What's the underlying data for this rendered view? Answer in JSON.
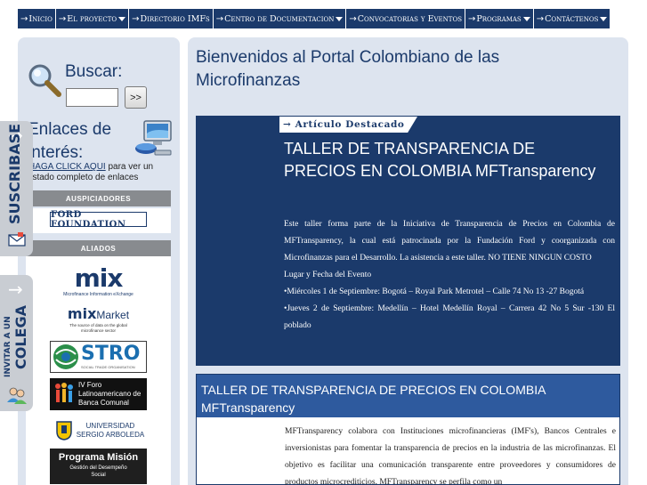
{
  "nav": {
    "items": [
      {
        "label": "Inicio",
        "dropdown": false
      },
      {
        "label": "El proyecto",
        "dropdown": true
      },
      {
        "label": "Directorio IMFs",
        "dropdown": false
      },
      {
        "label": "Centro de Documentacion",
        "dropdown": true
      },
      {
        "label": "Convocatorias y Eventos",
        "dropdown": false
      },
      {
        "label": "Programas",
        "dropdown": true
      },
      {
        "label": "Contáctenos",
        "dropdown": true
      }
    ],
    "arrow": "→"
  },
  "sidebar": {
    "search_title": "Buscar:",
    "search_value": "",
    "search_button": ">>",
    "links_title": "Enlaces de interés:",
    "links_link": "HAGA CLICK AQUI",
    "links_rest": " para ver un listado completo de enlaces",
    "sponsors_header": "AUSPICIADORES",
    "ford_logo": "FORD FOUNDATION",
    "allies_header": "ALIADOS",
    "mix_logo": "mix",
    "mix_tagline": "Microfinance Information eXchange",
    "mixmarket_logo": "mix",
    "mixmarket_word": "Market",
    "mixmarket_tagline": "The source of data on the global microfinance sector",
    "stro_logo": "STRO",
    "stro_tagline": "SOCIAL TRADE ORGANISATION",
    "foro_logo_line1": "IV Foro",
    "foro_logo_line2": "Latinoamericano de",
    "foro_logo_line3": "Banca Comunal",
    "usa_line1": "UNIVERSIDAD",
    "usa_line2": "SERGIO ARBOLEDA",
    "programa_line1": "Programa Misión",
    "programa_line2": "Gestión del Desempeño",
    "programa_line3": "Social"
  },
  "side_tabs": {
    "subscribe": "SUSCRIBASE",
    "invite_line1": "INVITAR A UN",
    "invite_line2": "COLEGA",
    "arrow": "→"
  },
  "main": {
    "title": "Bienvenidos al Portal Colombiano de las Microfinanzas",
    "featured": {
      "badge": "→ Artículo Destacado",
      "title": "TALLER DE TRANSPARENCIA DE PRECIOS EN COLOMBIA MFTransparency",
      "body": "Este taller forma parte de la Iniciativa de Transparencia de Precios en Colombia de MFTransparency, la cual está patrocinada por la Fundación Ford y coorganizada con Microfinanzas para el Desarrollo. La asistencia a este taller. NO TIENE NINGUN COSTO",
      "place_label": "Lugar y Fecha del Evento",
      "event1": "•Miércoles 1 de Septiembre: Bogotá – Royal Park Metrotel – Calle 74 No 13 -27 Bogotá",
      "event2": "•Jueves 2 de Septiembre: Medellín – Hotel Medellín Royal – Carrera 42 No 5 Sur -130 El poblado"
    },
    "article2": {
      "title": "TALLER DE TRANSPARENCIA DE PRECIOS EN COLOMBIA MFTransparency",
      "body": "MFTransparency colabora con Instituciones microfinancieras (IMF's), Bancos Centrales e inversionistas para fomentar la transparencia de precios en la industria de las microfinanzas. El objetivo es facilitar una comunicación transparente entre proveedores y consumidores de productos microcrediticios. MFTransparency se perfila como un"
    }
  },
  "colors": {
    "navy": "#1b3a6b",
    "panel": "#dde4ef",
    "header_blue": "#2e5a9e",
    "gray_header": "#888b8f"
  }
}
